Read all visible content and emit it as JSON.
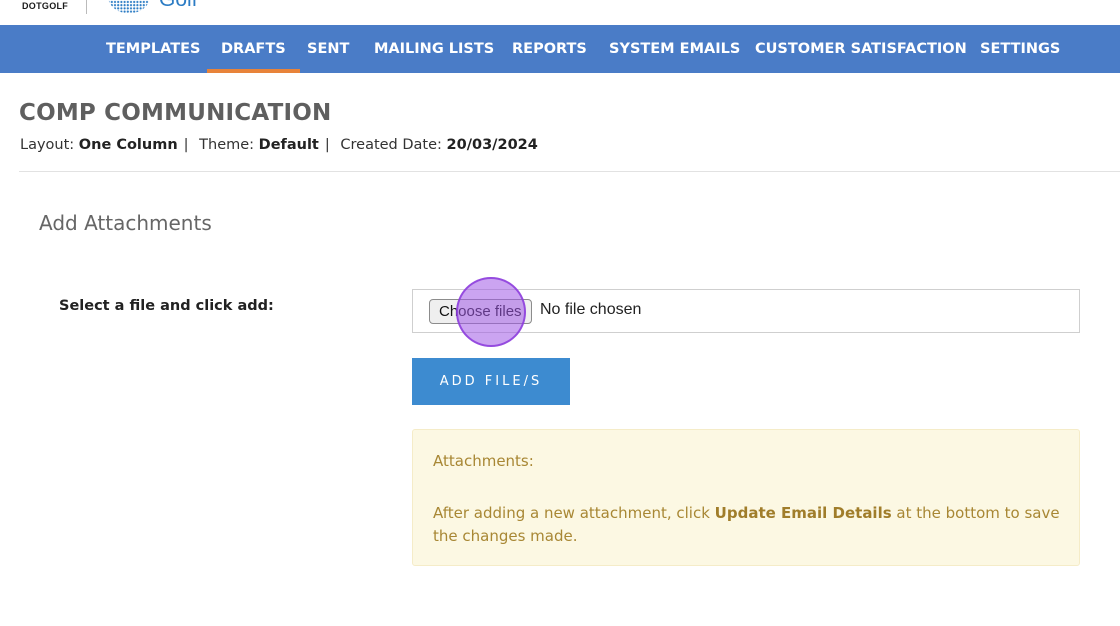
{
  "header": {
    "brand_left": "DOTGOLF",
    "brand_right": "Golf"
  },
  "nav": {
    "items": [
      {
        "label": "TEMPLATES",
        "active": false
      },
      {
        "label": "DRAFTS",
        "active": true
      },
      {
        "label": "SENT",
        "active": false
      },
      {
        "label": "MAILING LISTS",
        "active": false
      },
      {
        "label": "REPORTS",
        "active": false
      },
      {
        "label": "SYSTEM EMAILS",
        "active": false
      },
      {
        "label": "CUSTOMER SATISFACTION",
        "active": false
      },
      {
        "label": "SETTINGS",
        "active": false
      }
    ]
  },
  "page": {
    "title": "COMP COMMUNICATION",
    "layout_label": "Layout:",
    "layout_value": "One Column",
    "theme_label": "Theme:",
    "theme_value": "Default",
    "created_label": "Created Date:",
    "created_value": "20/03/2024",
    "separator": "|"
  },
  "attachments": {
    "section_title": "Add Attachments",
    "field_label": "Select a file and click add:",
    "choose_button": "Choose files",
    "no_file_text": "No file chosen",
    "add_button": "ADD FILE/S",
    "notice_title": "Attachments:",
    "notice_text_before": "After adding a new attachment, click ",
    "notice_text_bold": "Update Email Details",
    "notice_text_after": " at the bottom to save the changes made."
  },
  "colors": {
    "nav_background": "#4a7cc7",
    "nav_active_underline": "#e8833a",
    "add_button": "#3d8bd0",
    "notice_background": "#fcf8e3",
    "notice_text": "#a88734",
    "click_indicator": "#a05ae6"
  }
}
